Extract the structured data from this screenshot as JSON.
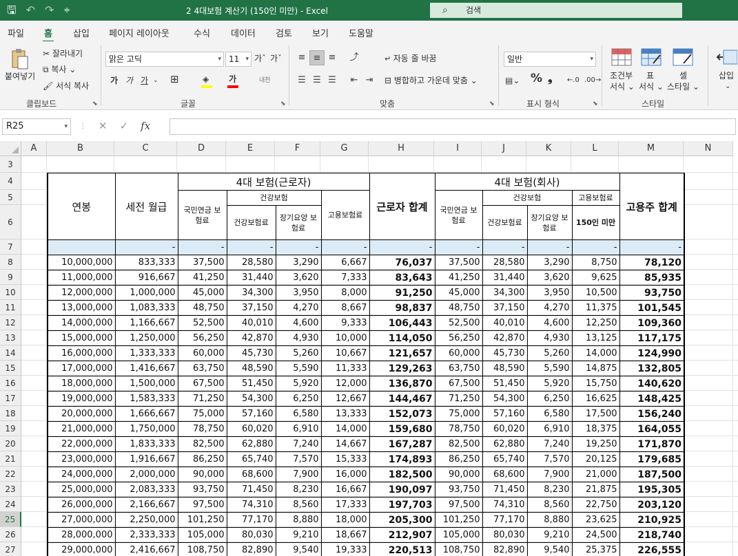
{
  "titlebar": {
    "title": "2 4대보험 계산기 (150인 미만)  -  Excel",
    "search_placeholder": "검색",
    "accent": "#217346"
  },
  "tabs": [
    "파일",
    "홈",
    "삽입",
    "페이지 레이아웃",
    "수식",
    "데이터",
    "검토",
    "보기",
    "도움말"
  ],
  "ribbon": {
    "clipboard": {
      "paste": "붙여넣기",
      "cut": "잘라내기",
      "copy": "복사",
      "format_painter": "서식 복사",
      "label": "클립보드"
    },
    "font": {
      "name": "맑은 고딕",
      "size": "11",
      "bold": "가",
      "italic": "가",
      "underline": "가",
      "font_color_glyph": "가",
      "phonetic": "내천",
      "label": "글꼴"
    },
    "alignment": {
      "wrap_text": "자동 줄 바꿈",
      "merge_center": "병합하고 가운데 맞춤",
      "label": "맞춤"
    },
    "number": {
      "format": "일반",
      "percent": "%",
      "comma": "❟",
      "label": "표시 형식"
    },
    "styles": {
      "conditional": "조건부",
      "conditional2": "서식",
      "table": "표",
      "table2": "서식",
      "cell": "셀",
      "cell2": "스타일",
      "label": "스타일"
    },
    "cells": {
      "insert": "삽입"
    }
  },
  "formula_bar": {
    "name_box": "R25",
    "fx": "fx",
    "value": ""
  },
  "columns": [
    "A",
    "B",
    "C",
    "D",
    "E",
    "F",
    "G",
    "H",
    "I",
    "J",
    "K",
    "L",
    "M",
    "N"
  ],
  "row_numbers": [
    "3",
    "4",
    "5",
    "6",
    "7",
    "8",
    "9",
    "10",
    "11",
    "12",
    "13",
    "14",
    "15",
    "16",
    "17",
    "18",
    "19",
    "20",
    "21",
    "22",
    "23",
    "24",
    "25",
    "26",
    "27"
  ],
  "selected_row": "25",
  "table": {
    "h_salary": "연봉",
    "h_monthly": "세전 월급",
    "h_worker_group": "4대 보험(근로자)",
    "h_worker_total": "근로자 합계",
    "h_company_group": "4대 보험(회사)",
    "h_employer_total": "고용주 합계",
    "h_pension": "국민연금 보험료",
    "h_health_group": "건강보험",
    "h_health": "건강보험료",
    "h_ltc": "장기요양 보험료",
    "h_employment": "고용보험료",
    "h_company_employment": "고용보험료",
    "h_under150": "150인 미만",
    "blank_row": [
      "-",
      "-",
      "-",
      "-",
      "-",
      "-",
      "-",
      "-",
      "-",
      "-",
      "-",
      "-"
    ],
    "rows": [
      [
        "10,000,000",
        "833,333",
        "37,500",
        "28,580",
        "3,290",
        "6,667",
        "76,037",
        "37,500",
        "28,580",
        "3,290",
        "8,750",
        "78,120"
      ],
      [
        "11,000,000",
        "916,667",
        "41,250",
        "31,440",
        "3,620",
        "7,333",
        "83,643",
        "41,250",
        "31,440",
        "3,620",
        "9,625",
        "85,935"
      ],
      [
        "12,000,000",
        "1,000,000",
        "45,000",
        "34,300",
        "3,950",
        "8,000",
        "91,250",
        "45,000",
        "34,300",
        "3,950",
        "10,500",
        "93,750"
      ],
      [
        "13,000,000",
        "1,083,333",
        "48,750",
        "37,150",
        "4,270",
        "8,667",
        "98,837",
        "48,750",
        "37,150",
        "4,270",
        "11,375",
        "101,545"
      ],
      [
        "14,000,000",
        "1,166,667",
        "52,500",
        "40,010",
        "4,600",
        "9,333",
        "106,443",
        "52,500",
        "40,010",
        "4,600",
        "12,250",
        "109,360"
      ],
      [
        "15,000,000",
        "1,250,000",
        "56,250",
        "42,870",
        "4,930",
        "10,000",
        "114,050",
        "56,250",
        "42,870",
        "4,930",
        "13,125",
        "117,175"
      ],
      [
        "16,000,000",
        "1,333,333",
        "60,000",
        "45,730",
        "5,260",
        "10,667",
        "121,657",
        "60,000",
        "45,730",
        "5,260",
        "14,000",
        "124,990"
      ],
      [
        "17,000,000",
        "1,416,667",
        "63,750",
        "48,590",
        "5,590",
        "11,333",
        "129,263",
        "63,750",
        "48,590",
        "5,590",
        "14,875",
        "132,805"
      ],
      [
        "18,000,000",
        "1,500,000",
        "67,500",
        "51,450",
        "5,920",
        "12,000",
        "136,870",
        "67,500",
        "51,450",
        "5,920",
        "15,750",
        "140,620"
      ],
      [
        "19,000,000",
        "1,583,333",
        "71,250",
        "54,300",
        "6,250",
        "12,667",
        "144,467",
        "71,250",
        "54,300",
        "6,250",
        "16,625",
        "148,425"
      ],
      [
        "20,000,000",
        "1,666,667",
        "75,000",
        "57,160",
        "6,580",
        "13,333",
        "152,073",
        "75,000",
        "57,160",
        "6,580",
        "17,500",
        "156,240"
      ],
      [
        "21,000,000",
        "1,750,000",
        "78,750",
        "60,020",
        "6,910",
        "14,000",
        "159,680",
        "78,750",
        "60,020",
        "6,910",
        "18,375",
        "164,055"
      ],
      [
        "22,000,000",
        "1,833,333",
        "82,500",
        "62,880",
        "7,240",
        "14,667",
        "167,287",
        "82,500",
        "62,880",
        "7,240",
        "19,250",
        "171,870"
      ],
      [
        "23,000,000",
        "1,916,667",
        "86,250",
        "65,740",
        "7,570",
        "15,333",
        "174,893",
        "86,250",
        "65,740",
        "7,570",
        "20,125",
        "179,685"
      ],
      [
        "24,000,000",
        "2,000,000",
        "90,000",
        "68,600",
        "7,900",
        "16,000",
        "182,500",
        "90,000",
        "68,600",
        "7,900",
        "21,000",
        "187,500"
      ],
      [
        "25,000,000",
        "2,083,333",
        "93,750",
        "71,450",
        "8,230",
        "16,667",
        "190,097",
        "93,750",
        "71,450",
        "8,230",
        "21,875",
        "195,305"
      ],
      [
        "26,000,000",
        "2,166,667",
        "97,500",
        "74,310",
        "8,560",
        "17,333",
        "197,703",
        "97,500",
        "74,310",
        "8,560",
        "22,750",
        "203,120"
      ],
      [
        "27,000,000",
        "2,250,000",
        "101,250",
        "77,170",
        "8,880",
        "18,000",
        "205,300",
        "101,250",
        "77,170",
        "8,880",
        "23,625",
        "210,925"
      ],
      [
        "28,000,000",
        "2,333,333",
        "105,000",
        "80,030",
        "9,210",
        "18,667",
        "212,907",
        "105,000",
        "80,030",
        "9,210",
        "24,500",
        "218,740"
      ],
      [
        "29,000,000",
        "2,416,667",
        "108,750",
        "82,890",
        "9,540",
        "19,333",
        "220,513",
        "108,750",
        "82,890",
        "9,540",
        "25,375",
        "226,555"
      ]
    ]
  }
}
